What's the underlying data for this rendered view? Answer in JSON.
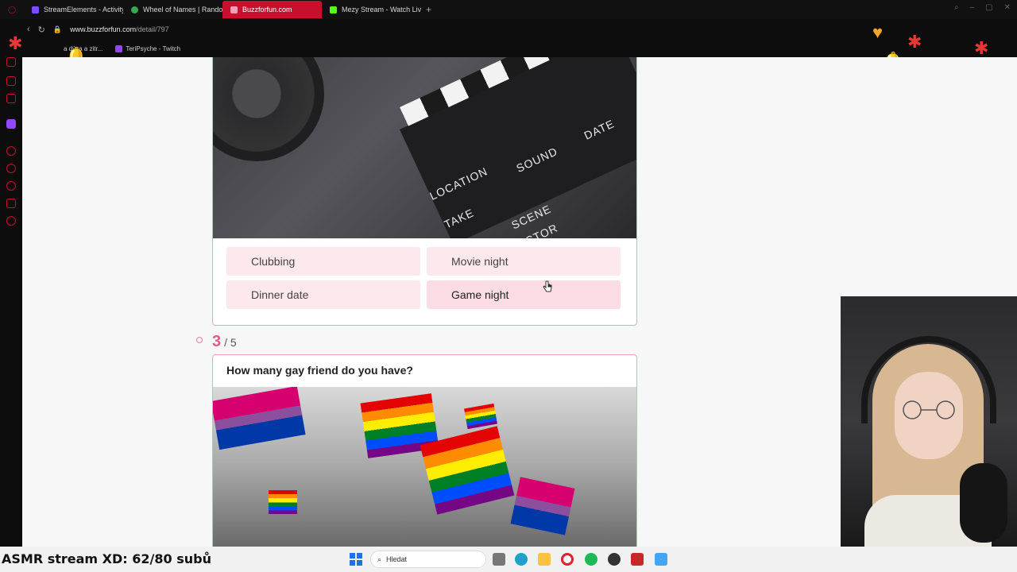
{
  "browser": {
    "tabs": [
      {
        "label": "StreamElements - Activity",
        "color": "#7b4dff"
      },
      {
        "label": "Wheel of Names | Random",
        "color": "#34a853"
      },
      {
        "label": "Buzzforfun.com",
        "color": "#c8102e",
        "active": true
      },
      {
        "label": "Mezy Stream - Watch Live",
        "color": "#53fc18"
      }
    ],
    "url_host": "www.buzzforfun.com",
    "url_path": "/detail/797",
    "bookmarks": [
      "a dýva a zitr...",
      "TeriPsyche - Twitch"
    ]
  },
  "quiz": {
    "question_prev_answers": [
      "Clubbing",
      "Movie night",
      "Dinner date",
      "Game night"
    ],
    "hero1_words": [
      "LOCATION",
      "SOUND",
      "DATE",
      "TAKE",
      "SCENE",
      "ECTOR"
    ],
    "current_number": "3",
    "total": "/ 5",
    "question_title": "How many gay friend do you have?"
  },
  "taskbar": {
    "overlay_text": "ASMR stream XD: 62/80 subů",
    "search_placeholder": "Hledat"
  },
  "colors": {
    "accent": "#e45b8a",
    "answer_bg": "#fde8ee",
    "card_border": "#f0a6b8",
    "opera_red": "#c8102e"
  }
}
